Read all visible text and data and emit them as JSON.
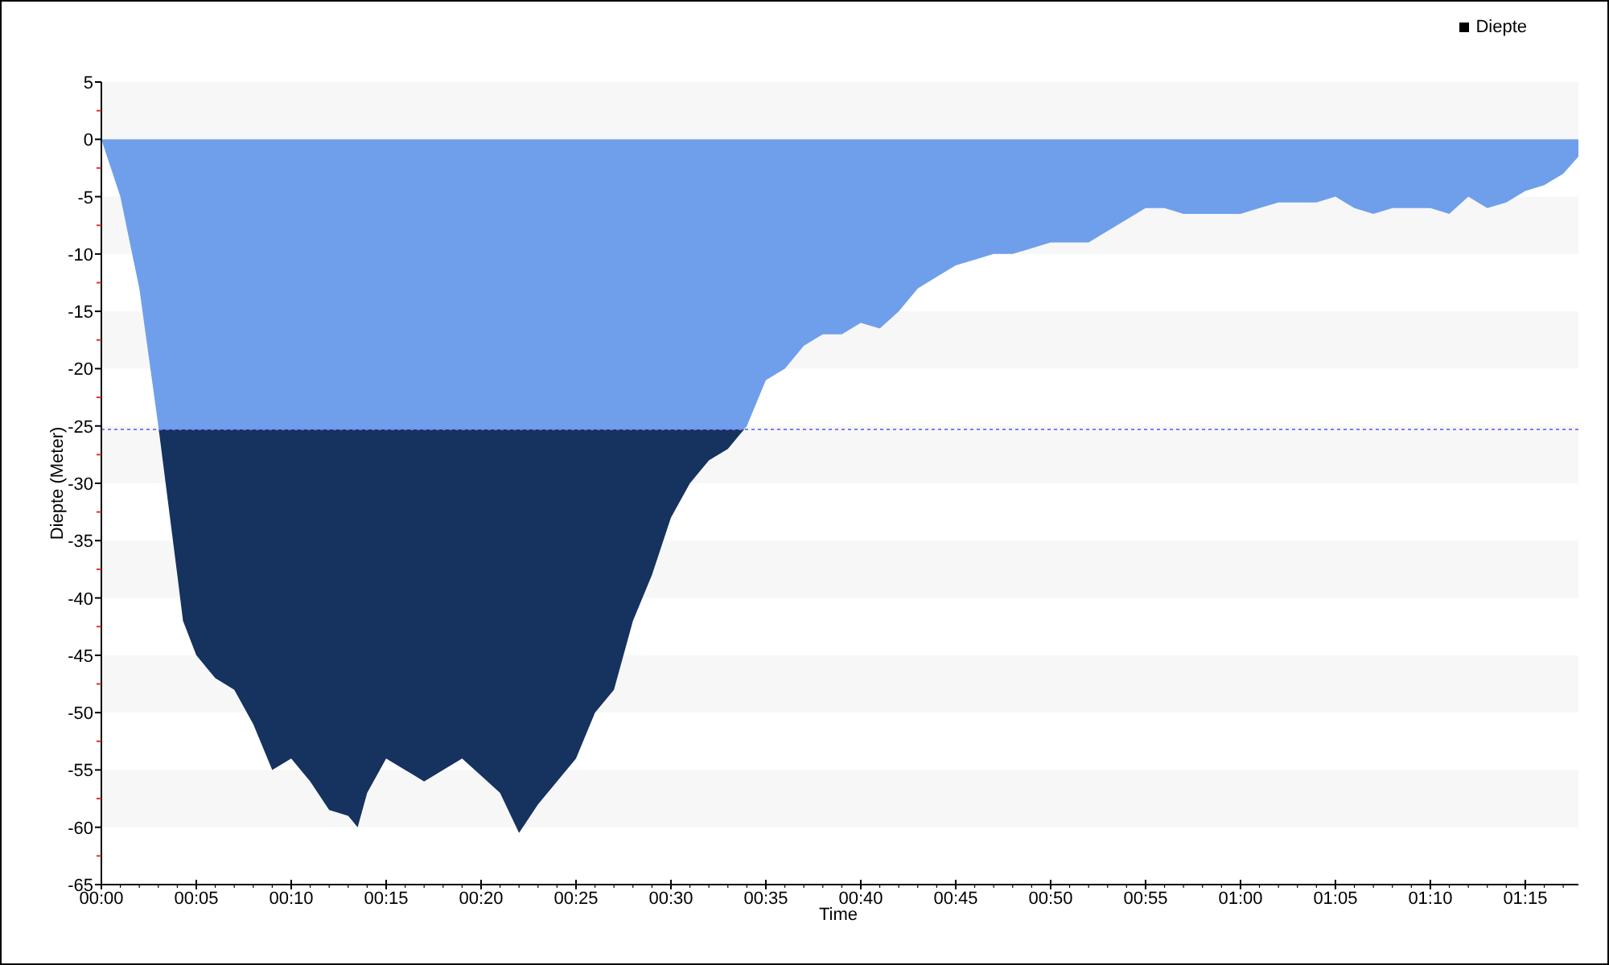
{
  "chart": {
    "chart_data": {
      "type": "area",
      "xlabel": "Time",
      "ylabel": "Diepte (Meter)",
      "x": [
        0,
        1,
        2,
        3,
        4,
        4.3,
        5,
        6,
        7,
        8,
        9,
        10,
        11,
        12,
        13,
        13.5,
        14,
        15,
        16,
        17,
        18,
        19,
        20,
        21,
        22,
        23,
        24,
        25,
        26,
        27,
        28,
        29,
        30,
        31,
        32,
        33,
        34,
        35,
        36,
        37,
        38,
        39,
        40,
        41,
        42,
        43,
        44,
        45,
        46,
        47,
        48,
        49,
        50,
        51,
        52,
        53,
        54,
        55,
        56,
        57,
        58,
        59,
        60,
        61,
        62,
        63,
        64,
        65,
        66,
        67,
        68,
        69,
        70,
        71,
        72,
        73,
        74,
        75,
        76,
        77,
        77.8
      ],
      "series": [
        {
          "name": "Diepte",
          "color": "#16325f",
          "values": [
            0,
            -5,
            -13,
            -25,
            -38,
            -42,
            -45,
            -47,
            -48,
            -51,
            -55,
            -54,
            -56,
            -58.5,
            -59,
            -60,
            -57,
            -54,
            -55,
            -56,
            -55,
            -54,
            -55.5,
            -57,
            -60.5,
            -58,
            -56,
            -54,
            -50,
            -48,
            -42,
            -38,
            -33,
            -30,
            -28,
            -27,
            -25,
            -21,
            -20,
            -18,
            -17,
            -17,
            -16,
            -16.5,
            -15,
            -13,
            -12,
            -11,
            -10.5,
            -10,
            -10,
            -9.5,
            -9,
            -9,
            -9,
            -8,
            -7,
            -6,
            -6,
            -6.5,
            -6.5,
            -6.5,
            -6.5,
            -6,
            -5.5,
            -5.5,
            -5.5,
            -5,
            -6,
            -6.5,
            -6,
            -6,
            -6,
            -6.5,
            -5,
            -6,
            -5.5,
            -4.5,
            -4,
            -3,
            -1.5
          ]
        }
      ],
      "xlim": [
        0,
        77.8
      ],
      "ylim": [
        -65,
        5
      ],
      "xticks": [
        {
          "value": 0,
          "label": "00:00"
        },
        {
          "value": 5,
          "label": "00:05"
        },
        {
          "value": 10,
          "label": "00:10"
        },
        {
          "value": 15,
          "label": "00:15"
        },
        {
          "value": 20,
          "label": "00:20"
        },
        {
          "value": 25,
          "label": "00:25"
        },
        {
          "value": 30,
          "label": "00:30"
        },
        {
          "value": 35,
          "label": "00:35"
        },
        {
          "value": 40,
          "label": "00:40"
        },
        {
          "value": 45,
          "label": "00:45"
        },
        {
          "value": 50,
          "label": "00:50"
        },
        {
          "value": 55,
          "label": "00:55"
        },
        {
          "value": 60,
          "label": "01:00"
        },
        {
          "value": 65,
          "label": "01:05"
        },
        {
          "value": 70,
          "label": "01:10"
        },
        {
          "value": 75,
          "label": "01:15"
        }
      ],
      "yticks": [
        5,
        0,
        -5,
        -10,
        -15,
        -20,
        -25,
        -30,
        -35,
        -40,
        -45,
        -50,
        -55,
        -60,
        -65
      ],
      "ref_lines": [
        {
          "axis": "y",
          "value": -25.3,
          "color": "#7b7bff"
        }
      ]
    }
  }
}
